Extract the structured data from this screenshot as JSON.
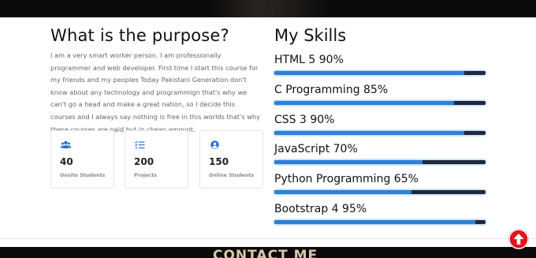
{
  "about": {
    "title": "What is the purpose?",
    "text": "I am a very smart worker person. I am professionally programmer and web developer. First time I start this course for my friends and my peoples Today Pakistani Generation don't know about any technology and programmign that's why we can't go a head and make a great nation, so I decide this courses and I always say nothing is free in this worlds that's why these courses are paid but in cheap amount."
  },
  "stats": [
    {
      "icon": "users-icon",
      "value": "40",
      "label": "Onsite Students"
    },
    {
      "icon": "tasks-list-icon",
      "value": "200",
      "label": "Projects"
    },
    {
      "icon": "user-circle-icon",
      "value": "150",
      "label": "Online Students"
    }
  ],
  "skills": {
    "title": "My Skills",
    "items": [
      {
        "label": "HTML 5 90%",
        "level": 0.9
      },
      {
        "label": "C Programming 85%",
        "level": 0.85
      },
      {
        "label": "CSS 3 90%",
        "level": 0.9
      },
      {
        "label": "JavaScript 70%",
        "level": 0.7
      },
      {
        "label": "Python Programming 65%",
        "level": 0.65
      },
      {
        "label": "Bootstrap 4 95%",
        "level": 0.95
      }
    ]
  },
  "footer": {
    "contact_heading": "CONTACT ME"
  },
  "scroll_top": {
    "icon": "arrow-up-circle-icon"
  },
  "colors": {
    "accent": "#2f7fd9",
    "bar_track": "#22283a",
    "icon_blue": "#2a6fd1",
    "scroll_red": "#e0141b"
  }
}
